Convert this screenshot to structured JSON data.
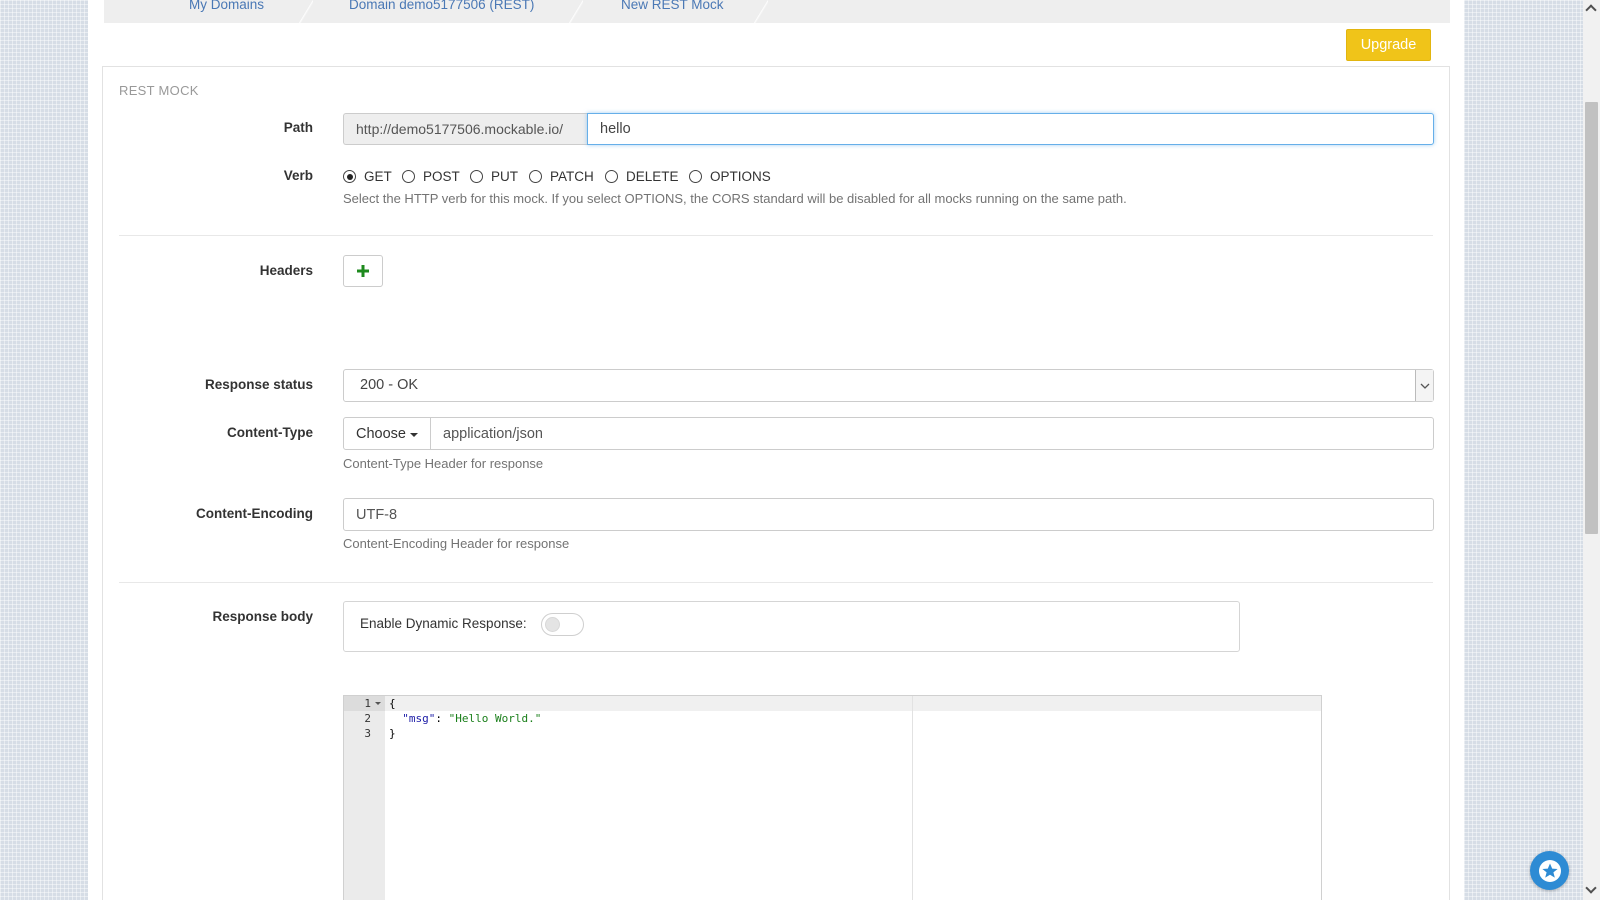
{
  "breadcrumb": {
    "items": [
      "My Domains",
      "Domain demo5177506 (REST)",
      "New REST Mock"
    ]
  },
  "header": {
    "upgrade_label": "Upgrade"
  },
  "panel": {
    "title": "REST MOCK"
  },
  "path": {
    "label": "Path",
    "prefix": "http://demo5177506.mockable.io/",
    "value": "hello"
  },
  "verb": {
    "label": "Verb",
    "options": [
      "GET",
      "POST",
      "PUT",
      "PATCH",
      "DELETE",
      "OPTIONS"
    ],
    "selected": "GET",
    "help": "Select the HTTP verb for this mock. If you select OPTIONS, the CORS standard will be disabled for all mocks running on the same path."
  },
  "headers": {
    "label": "Headers"
  },
  "response_status": {
    "label": "Response status",
    "value": "200 - OK"
  },
  "content_type": {
    "label": "Content-Type",
    "choose_label": "Choose",
    "value": "application/json",
    "help": "Content-Type Header for response"
  },
  "content_encoding": {
    "label": "Content-Encoding",
    "value": "UTF-8",
    "help": "Content-Encoding Header for response"
  },
  "response_body": {
    "label": "Response body",
    "dynamic_label": "Enable Dynamic Response:",
    "dynamic_enabled": false,
    "lines": [
      {
        "num": "1",
        "text": "{"
      },
      {
        "num": "2",
        "key": "\"msg\"",
        "sep": ": ",
        "value": "\"Hello World.\""
      },
      {
        "num": "3",
        "text": "}"
      }
    ]
  },
  "colors": {
    "accent": "#f0c419",
    "link": "#4a78b5",
    "fab": "#2d8bd4",
    "plus": "#1e8a1e"
  },
  "icons": {
    "add_header": "plus-icon",
    "select_arrow": "chevron-down-icon",
    "fab": "star-icon"
  }
}
